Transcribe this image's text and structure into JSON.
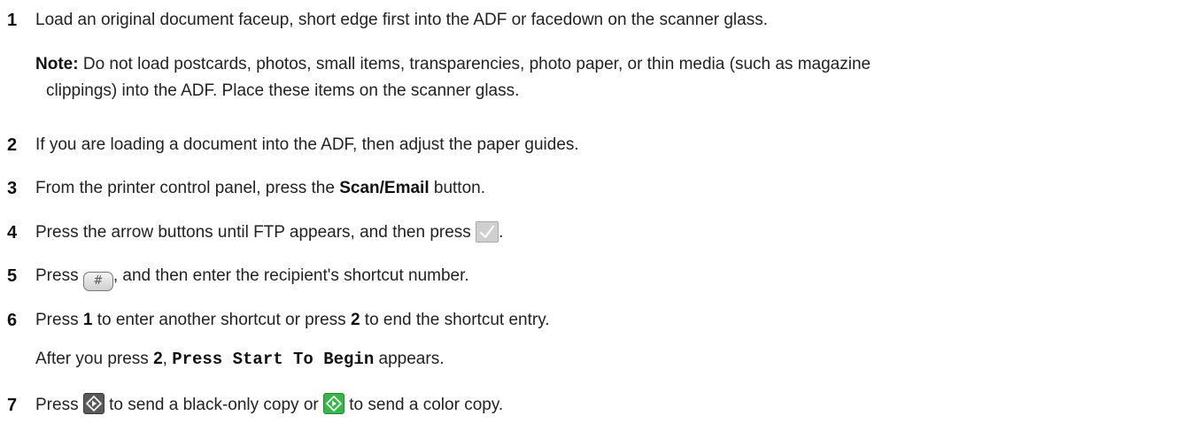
{
  "steps": [
    {
      "number": "1",
      "text": "Load an original document faceup, short edge first into the ADF or facedown on the scanner glass."
    },
    {
      "number": "2",
      "text": "If you are loading a document into the ADF, then adjust the paper guides."
    },
    {
      "number": "3",
      "text_before": "From the printer control panel, press the ",
      "bold": "Scan/Email",
      "text_after": " button."
    },
    {
      "number": "4",
      "text_before": "Press the arrow buttons until FTP appears, and then press ",
      "icon": "checkmark-button-icon",
      "text_after": "."
    },
    {
      "number": "5",
      "text_before": "Press ",
      "icon_label": "#",
      "text_after": ", and then enter the recipient's shortcut number."
    },
    {
      "number": "6",
      "text_1": "Press ",
      "bold_1": "1",
      "text_2": " to enter another shortcut or press ",
      "bold_2": "2",
      "text_3": " to end the shortcut entry.",
      "follow_1": "After you press ",
      "follow_bold": "2",
      "follow_2": ", ",
      "follow_mono": "Press Start To Begin",
      "follow_3": " appears."
    },
    {
      "number": "7",
      "text_1": "Press ",
      "icon_1": "black-start-button-icon",
      "text_2": " to send a black-only copy or ",
      "icon_2": "color-start-button-icon",
      "text_3": " to send a color copy."
    }
  ],
  "note": {
    "label": "Note:",
    "line_1": " Do not load postcards, photos, small items, transparencies, photo paper, or thin media (such as magazine",
    "line_2": "clippings) into the ADF. Place these items on the scanner glass."
  },
  "colors": {
    "black_start": "#5a5a5a",
    "color_start": "#39b54a",
    "check_button": "#cfcfcf"
  }
}
